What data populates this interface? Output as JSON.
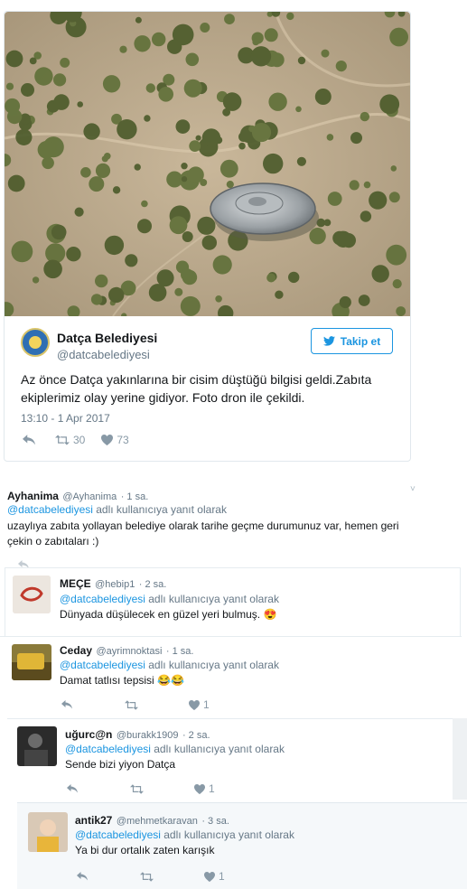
{
  "tweet": {
    "author": "Datça Belediyesi",
    "handle": "@datcabelediyesi",
    "follow_label": "Takip et",
    "text": "Az önce Datça yakınlarına bir cisim düştüğü bilgisi geldi.Zabıta ekiplerimiz olay yerine gidiyor. Foto dron ile çekildi.",
    "time": "13:10 - 1 Apr 2017",
    "retweets": "30",
    "likes": "73"
  },
  "replies": [
    {
      "name": "Ayhanima",
      "handle": "@Ayhanima",
      "time": "· 1 sa.",
      "mention": "@datcabelediyesi",
      "reply_suffix": " adlı kullanıcıya yanıt olarak",
      "text": "uzaylıya zabıta yollayan belediye olarak tarihe geçme durumunuz var, hemen geri çekin o zabıtaları :)",
      "likes": ""
    },
    {
      "name": "MEÇE",
      "handle": "@hebip1",
      "time": "· 2 sa.",
      "mention": "@datcabelediyesi",
      "reply_suffix": " adlı kullanıcıya yanıt olarak",
      "text": "Dünyada düşülecek en güzel yeri bulmuş.",
      "emoji": "😍",
      "likes": ""
    },
    {
      "name": "Ceday",
      "handle": "@ayrimnoktasi",
      "time": "· 1 sa.",
      "mention": "@datcabelediyesi",
      "reply_suffix": " adlı kullanıcıya yanıt olarak",
      "text": "Damat tatlısı tepsisi",
      "emoji": "😂😂",
      "likes": "1"
    },
    {
      "name": "uğurc@n",
      "handle": "@burakk1909",
      "time": "· 2 sa.",
      "mention": "@datcabelediyesi",
      "reply_suffix": " adlı kullanıcıya yanıt olarak",
      "text": "Sende bizi yiyon Datça",
      "likes": "1"
    },
    {
      "name": "antik27",
      "handle": "@mehmetkaravan",
      "time": "· 3 sa.",
      "mention": "@datcabelediyesi",
      "reply_suffix": " adlı kullanıcıya yanıt olarak",
      "text": "Ya bi dur ortalık zaten karışık",
      "likes": "1"
    }
  ],
  "colors": {
    "link": "#1b95e0",
    "muted": "#657786",
    "icon": "#8899a6",
    "border": "#e1e8ed"
  }
}
